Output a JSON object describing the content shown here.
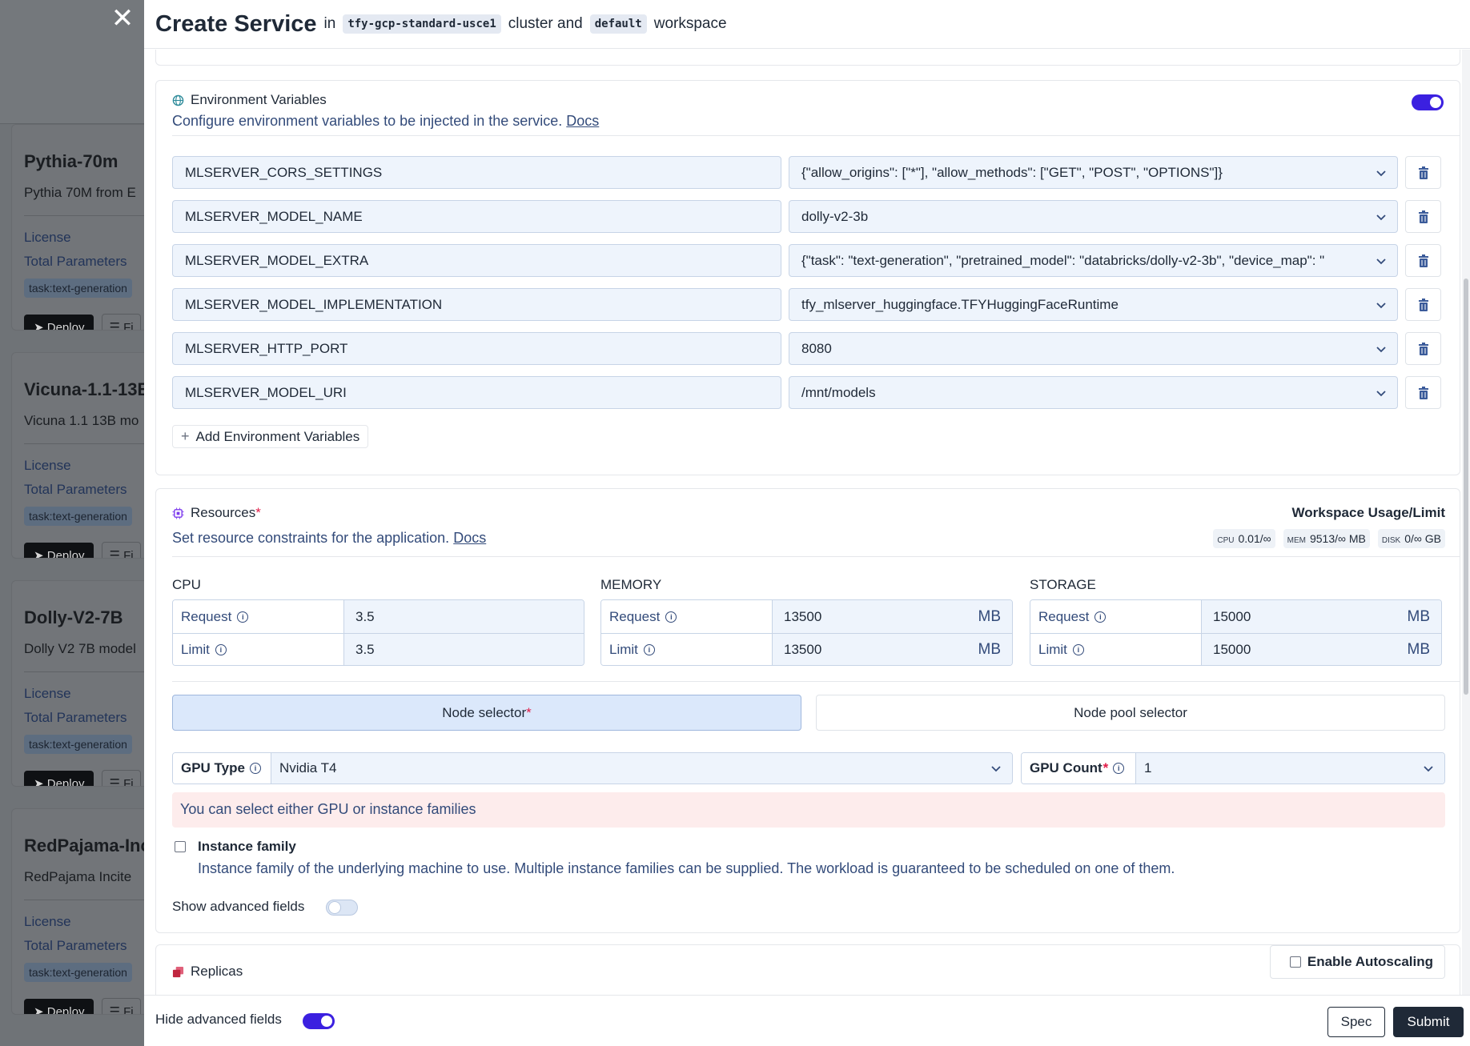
{
  "background": {
    "cards": [
      {
        "title": "Pythia-70m",
        "desc": "Pythia 70M from E",
        "license": "License",
        "params": "Total Parameters",
        "tag": "task:text-generation",
        "deploy": "Deploy",
        "fi": "Fi"
      },
      {
        "title": "Vicuna-1.1-13B",
        "desc": "Vicuna 1.1 13B mo",
        "license": "License",
        "params": "Total Parameters",
        "tag": "task:text-generation",
        "deploy": "Deploy",
        "fi": "Fi"
      },
      {
        "title": "Dolly-V2-7B",
        "desc": "Dolly V2 7B model",
        "license": "License",
        "params": "Total Parameters",
        "tag": "task:text-generation",
        "deploy": "Deploy",
        "fi": "Fi"
      },
      {
        "title": "RedPajama-Inc",
        "desc": "RedPajama Incite",
        "license": "License",
        "params": "Total Parameters",
        "tag": "task:text-generation",
        "deploy": "Deploy",
        "fi": "Fi"
      }
    ]
  },
  "header": {
    "title": "Create Service",
    "in": "in",
    "cluster": "tfy-gcp-standard-usce1",
    "cluster_and": "cluster and",
    "workspace": "default",
    "workspace_label": "workspace"
  },
  "env": {
    "title": "Environment Variables",
    "desc": "Configure environment variables to be injected in the service.",
    "docs": "Docs",
    "enabled": true,
    "rows": [
      {
        "key": "MLSERVER_CORS_SETTINGS",
        "value": "{\"allow_origins\": [\"*\"], \"allow_methods\": [\"GET\", \"POST\", \"OPTIONS\"]}"
      },
      {
        "key": "MLSERVER_MODEL_NAME",
        "value": "dolly-v2-3b"
      },
      {
        "key": "MLSERVER_MODEL_EXTRA",
        "value": "{\"task\": \"text-generation\", \"pretrained_model\": \"databricks/dolly-v2-3b\", \"device_map\": \""
      },
      {
        "key": "MLSERVER_MODEL_IMPLEMENTATION",
        "value": "tfy_mlserver_huggingface.TFYHuggingFaceRuntime"
      },
      {
        "key": "MLSERVER_HTTP_PORT",
        "value": "8080"
      },
      {
        "key": "MLSERVER_MODEL_URI",
        "value": "/mnt/models"
      }
    ],
    "add_label": "Add Environment Variables"
  },
  "resources": {
    "title": "Resources",
    "required_mark": "*",
    "desc": "Set resource constraints for the application.",
    "docs": "Docs",
    "usage_title": "Workspace Usage/Limit",
    "usage": [
      {
        "key": "CPU",
        "value": "0.01/∞"
      },
      {
        "key": "MEM",
        "value": "9513/∞ MB"
      },
      {
        "key": "DISK",
        "value": "0/∞ GB"
      }
    ],
    "cpu": {
      "label": "CPU",
      "request_label": "Request",
      "limit_label": "Limit",
      "request": "3.5",
      "limit": "3.5",
      "unit": ""
    },
    "memory": {
      "label": "MEMORY",
      "request_label": "Request",
      "limit_label": "Limit",
      "request": "13500",
      "limit": "13500",
      "unit": "MB"
    },
    "storage": {
      "label": "STORAGE",
      "request_label": "Request",
      "limit_label": "Limit",
      "request": "15000",
      "limit": "15000",
      "unit": "MB"
    },
    "node_selector": "Node selector",
    "node_pool_selector": "Node pool selector",
    "gpu_type_label": "GPU Type",
    "gpu_type_value": "Nvidia T4",
    "gpu_count_label": "GPU Count",
    "gpu_count_value": "1",
    "warning": "You can select either GPU or instance families",
    "instance_family_label": "Instance family",
    "instance_family_desc": "Instance family of the underlying machine to use. Multiple instance families can be supplied. The workload is guaranteed to be scheduled on one of them.",
    "show_advanced": "Show advanced fields"
  },
  "replicas": {
    "title": "Replicas",
    "autoscaling_label": "Enable Autoscaling"
  },
  "footer": {
    "hide_advanced": "Hide advanced fields",
    "spec": "Spec",
    "submit": "Submit"
  },
  "colors": {
    "accent": "#3b20e0",
    "warning_bg": "#fdecec",
    "link": "#334b7a"
  }
}
